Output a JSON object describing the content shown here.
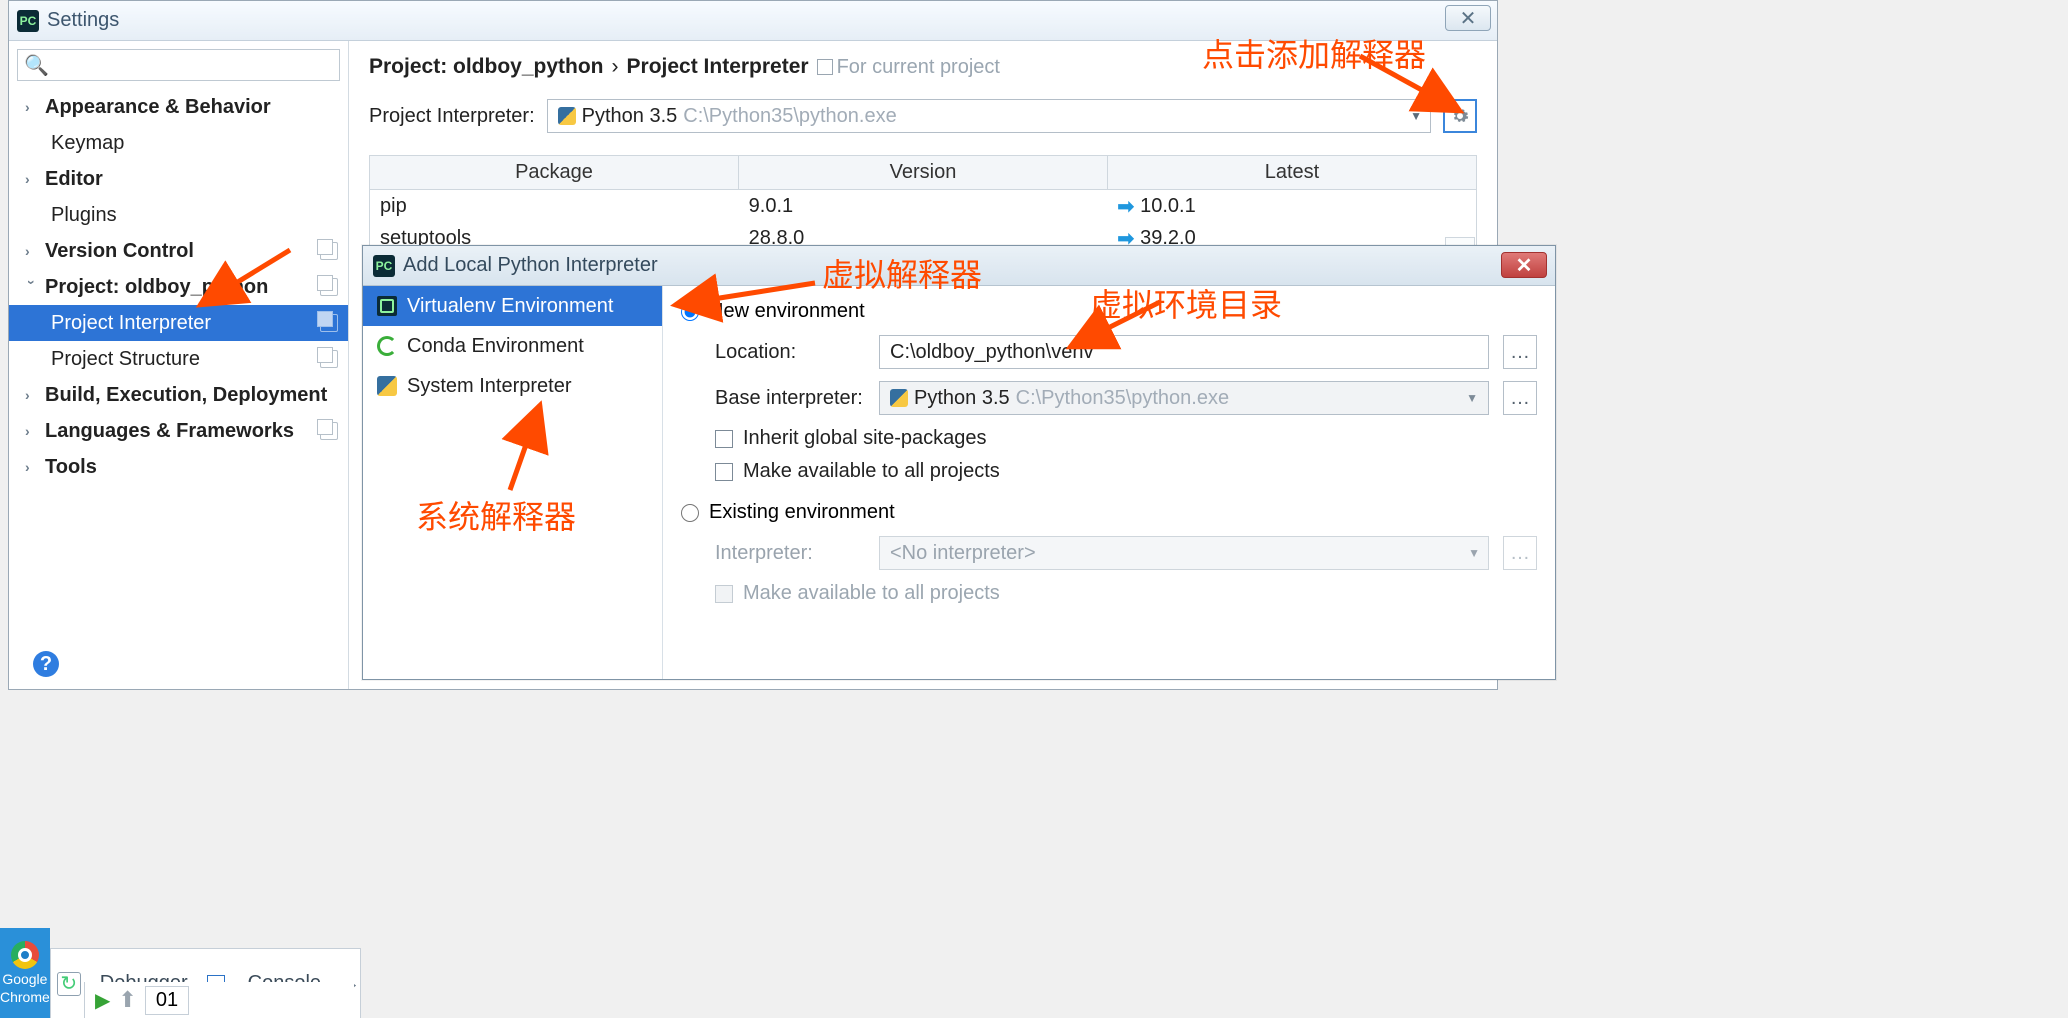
{
  "settings": {
    "title": "Settings",
    "search_placeholder": "",
    "tree": {
      "appearance": "Appearance & Behavior",
      "keymap": "Keymap",
      "editor": "Editor",
      "plugins": "Plugins",
      "vcs": "Version Control",
      "project": "Project: oldboy_python",
      "project_interpreter": "Project Interpreter",
      "project_structure": "Project Structure",
      "build": "Build, Execution, Deployment",
      "lang": "Languages & Frameworks",
      "tools": "Tools"
    },
    "breadcrumb": {
      "a": "Project: oldboy_python",
      "b": "Project Interpreter",
      "scope": "For current project"
    },
    "interp_label": "Project Interpreter:",
    "interp_name": "Python 3.5",
    "interp_path": "C:\\Python35\\python.exe",
    "table": {
      "h_package": "Package",
      "h_version": "Version",
      "h_latest": "Latest",
      "rows": [
        {
          "pkg": "pip",
          "ver": "9.0.1",
          "latest": "10.0.1"
        },
        {
          "pkg": "setuptools",
          "ver": "28.8.0",
          "latest": "39.2.0"
        }
      ]
    }
  },
  "dialog": {
    "title": "Add Local Python Interpreter",
    "left": {
      "venv": "Virtualenv Environment",
      "conda": "Conda Environment",
      "system": "System Interpreter"
    },
    "right": {
      "new_env": "New environment",
      "location_label": "Location:",
      "location_value": "C:\\oldboy_python\\venv",
      "base_label": "Base interpreter:",
      "base_name": "Python 3.5",
      "base_path": "C:\\Python35\\python.exe",
      "inherit": "Inherit global site-packages",
      "make_avail": "Make available to all projects",
      "existing": "Existing environment",
      "interp_label": "Interpreter:",
      "no_interp": "<No interpreter>",
      "make_avail2": "Make available to all projects"
    }
  },
  "annotations": {
    "a1": "点击添加解释器",
    "a2": "虚拟解释器",
    "a3": "虚拟环境目录",
    "a4": "系统解释器"
  },
  "bottom": {
    "chrome1": "Google",
    "chrome2": "Chrome",
    "debugger": "Debugger",
    "console": "Console",
    "num": "01"
  }
}
